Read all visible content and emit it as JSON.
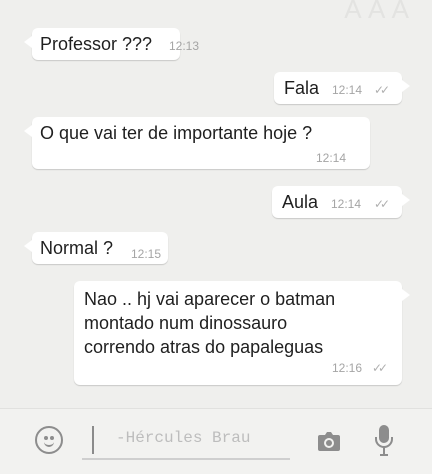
{
  "chat": {
    "wallpaper_text": "A A A",
    "messages": [
      {
        "text": "Professor ???",
        "time": "12:13",
        "direction": "incoming"
      },
      {
        "text": "Fala",
        "time": "12:14",
        "direction": "outgoing"
      },
      {
        "text": "O que vai ter de importante hoje ?",
        "time": "12:14",
        "direction": "incoming"
      },
      {
        "text": "Aula",
        "time": "12:14",
        "direction": "outgoing"
      },
      {
        "text": "Normal ?",
        "time": "12:15",
        "direction": "incoming"
      },
      {
        "text": "Nao .. hj vai aparecer o batman\nmontado num dinossauro\ncorrendo atras do papaleguas",
        "time": "12:16",
        "direction": "outgoing"
      }
    ],
    "read_receipt": "✓✓"
  },
  "input": {
    "placeholder": "-Hércules Brau"
  },
  "icons": {
    "emoji": "smiley-icon",
    "camera": "camera-icon",
    "microphone": "microphone-icon"
  },
  "colors": {
    "chat_background": "#efefed",
    "bubble": "#ffffff",
    "timestamp": "#a5a5a5",
    "icon": "#8d8d8d"
  }
}
